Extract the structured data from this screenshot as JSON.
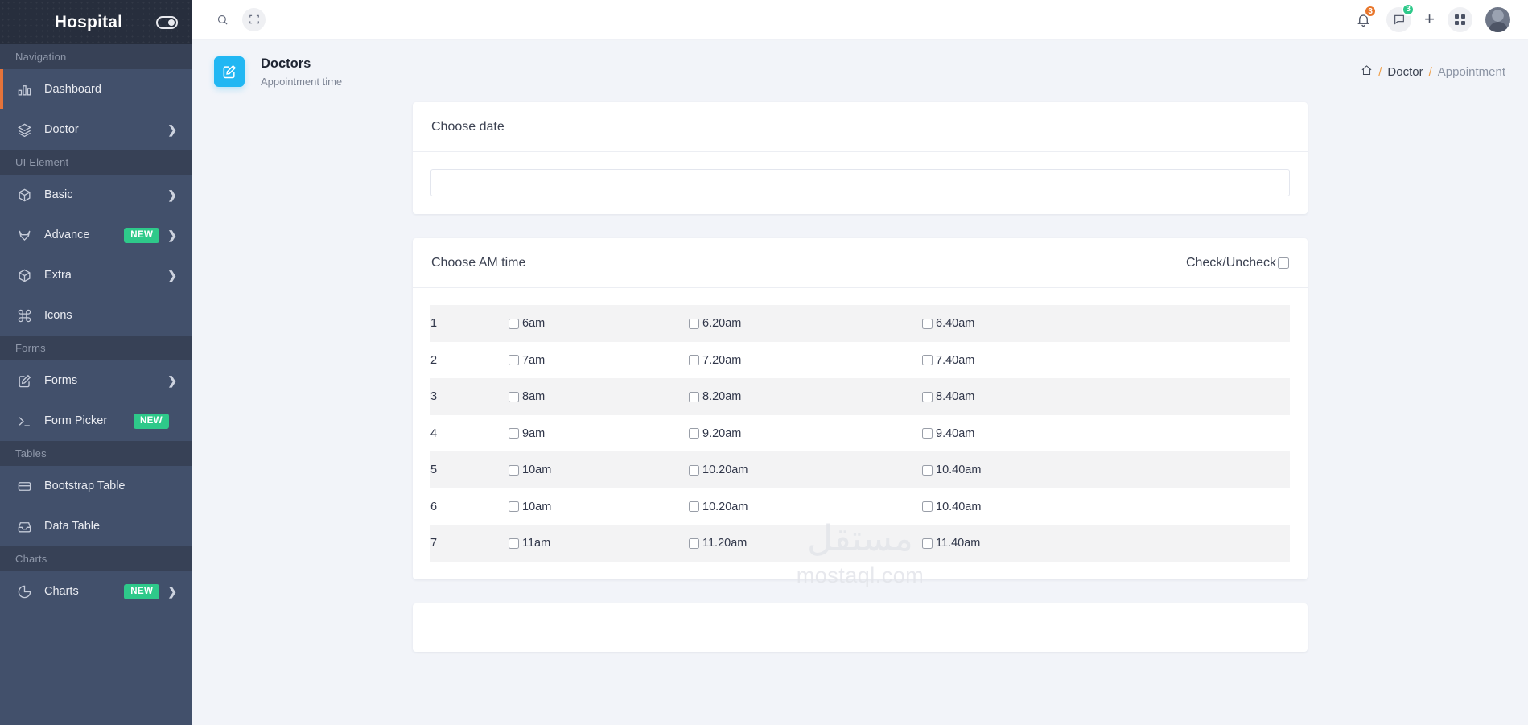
{
  "sidebar": {
    "brand": "Hospital",
    "toggle_icon": "toggle-switch-icon",
    "sections": [
      {
        "caption": "Navigation",
        "items": [
          {
            "label": "Dashboard",
            "icon": "bar-chart-icon",
            "badge": "",
            "chevron": false,
            "active": true
          },
          {
            "label": "Doctor",
            "icon": "layers-icon",
            "badge": "",
            "chevron": true,
            "active": false
          }
        ]
      },
      {
        "caption": "UI Element",
        "items": [
          {
            "label": "Basic",
            "icon": "box-icon",
            "badge": "",
            "chevron": true,
            "active": false
          },
          {
            "label": "Advance",
            "icon": "gitlab-icon",
            "badge": "NEW",
            "chevron": true,
            "active": false
          },
          {
            "label": "Extra",
            "icon": "box-icon",
            "badge": "",
            "chevron": true,
            "active": false
          },
          {
            "label": "Icons",
            "icon": "command-icon",
            "badge": "",
            "chevron": false,
            "active": false
          }
        ]
      },
      {
        "caption": "Forms",
        "items": [
          {
            "label": "Forms",
            "icon": "edit-square-icon",
            "badge": "",
            "chevron": true,
            "active": false
          },
          {
            "label": "Form Picker",
            "icon": "terminal-icon",
            "badge": "NEW",
            "chevron": false,
            "active": false
          }
        ]
      },
      {
        "caption": "Tables",
        "items": [
          {
            "label": "Bootstrap Table",
            "icon": "table-icon",
            "badge": "",
            "chevron": false,
            "active": false
          },
          {
            "label": "Data Table",
            "icon": "inbox-icon",
            "badge": "",
            "chevron": false,
            "active": false
          }
        ]
      },
      {
        "caption": "Charts",
        "items": [
          {
            "label": "Charts",
            "icon": "pie-chart-icon",
            "badge": "NEW",
            "chevron": true,
            "active": false
          }
        ]
      }
    ]
  },
  "topbar": {
    "search_icon": "search-icon",
    "fullscreen_icon": "fullscreen-icon",
    "bell_icon": "bell-icon",
    "bell_count": "3",
    "chat_icon": "chat-bubble-icon",
    "chat_count": "3",
    "plus_label": "+",
    "grid_icon": "grid-apps-icon",
    "avatar_icon": "user-avatar"
  },
  "page_header": {
    "icon": "edit-square-icon",
    "title": "Doctors",
    "subtitle": "Appointment time",
    "breadcrumb": {
      "home_icon": "home-icon",
      "sep1": "/",
      "item1": "Doctor",
      "sep2": "/",
      "item2": "Appointment"
    }
  },
  "date_card": {
    "title": "Choose date",
    "input_value": "",
    "input_placeholder": ""
  },
  "am_card": {
    "title": "Choose AM time",
    "check_uncheck_label": "Check/Uncheck",
    "rows": [
      {
        "num": "1",
        "a": "6am",
        "b": "6.20am",
        "c": "6.40am"
      },
      {
        "num": "2",
        "a": "7am",
        "b": "7.20am",
        "c": "7.40am"
      },
      {
        "num": "3",
        "a": "8am",
        "b": "8.20am",
        "c": "8.40am"
      },
      {
        "num": "4",
        "a": "9am",
        "b": "9.20am",
        "c": "9.40am"
      },
      {
        "num": "5",
        "a": "10am",
        "b": "10.20am",
        "c": "10.40am"
      },
      {
        "num": "6",
        "a": "10am",
        "b": "10.20am",
        "c": "10.40am"
      },
      {
        "num": "7",
        "a": "11am",
        "b": "11.20am",
        "c": "11.40am"
      }
    ]
  },
  "watermark": {
    "arabic": "مستقل",
    "latin": "mostaql.com"
  },
  "colors": {
    "sidebar_bg": "#42506b",
    "sidebar_caption_bg": "#374156",
    "brand_bg": "#272e3d",
    "accent_orange": "#e4733a",
    "badge_green": "#2ec98a",
    "page_icon_blue": "#21b7f3",
    "page_bg": "#f2f4f9",
    "row_stripe": "#f3f3f4"
  }
}
